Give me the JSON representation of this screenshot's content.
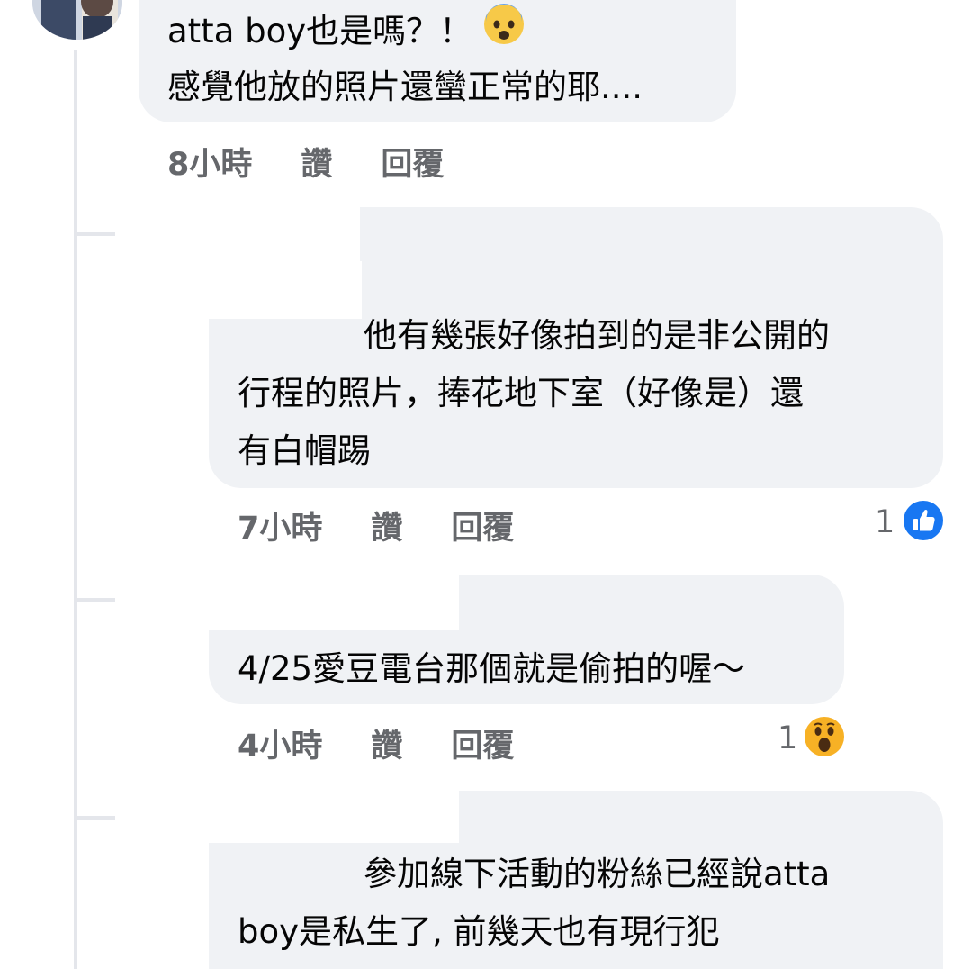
{
  "comments": [
    {
      "line1": "atta boy也是嗎？！",
      "emoji": "fearful-face",
      "line2": "感覺他放的照片還蠻正常的耶....",
      "time": "8小時",
      "like": "讚",
      "reply": "回覆"
    },
    {
      "line1": "他有幾張好像拍到的是非公開的",
      "line2": "行程的照片，捧花地下室（好像是）還",
      "line3": "有白帽踢",
      "time": "7小時",
      "like": "讚",
      "reply": "回覆",
      "reaction_count": "1",
      "reaction": "like"
    },
    {
      "line1": "4/25愛豆電台那個就是偷拍的喔～",
      "time": "4小時",
      "like": "讚",
      "reply": "回覆",
      "reaction_count": "1",
      "reaction": "wow"
    },
    {
      "line1": "參加線下活動的粉絲已經說atta",
      "line2": "boy是私生了, 前幾天也有現行犯"
    }
  ],
  "colors": {
    "bubble": "#f0f2f5",
    "meta_text": "#65676b",
    "like_blue": "#1877f2",
    "wow_yellow": "#f7b125"
  }
}
